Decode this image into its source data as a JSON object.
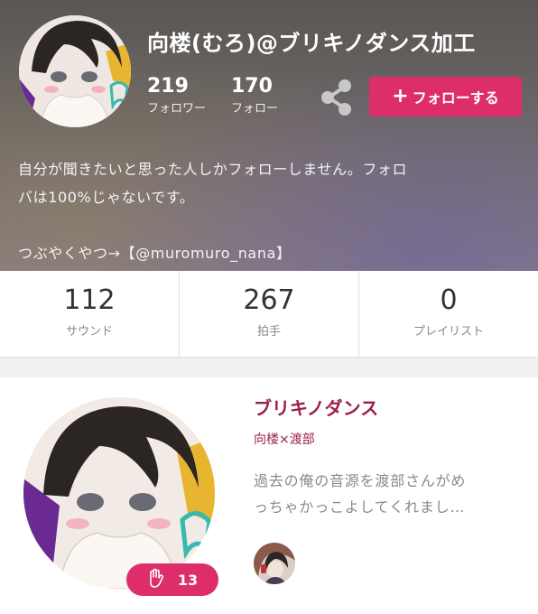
{
  "profile": {
    "username": "向楼(むろ)@ブリキノダンス加工",
    "followers_count": "219",
    "followers_label": "フォロワー",
    "following_count": "170",
    "following_label": "フォロー",
    "follow_button_label": "フォローする",
    "follow_plus": "+",
    "bio_lines": [
      "自分が聞きたいと思った人しかフォローしません。フォロ",
      "バは100%じゃないです。",
      "つぶやくやつ→【@muromuro_nana】"
    ],
    "share_icon": "share-icon"
  },
  "counts": [
    {
      "value": "112",
      "label": "サウンド"
    },
    {
      "value": "267",
      "label": "拍手"
    },
    {
      "value": "0",
      "label": "プレイリスト"
    }
  ],
  "track": {
    "title": "ブリキノダンス",
    "artist": "向楼×渡部",
    "description_lines": [
      "過去の俺の音源を渡部さんがめ",
      "っちゃかっこよしてくれまし…"
    ],
    "claps": "13",
    "clap_icon": "clap-hand-icon"
  },
  "colors": {
    "accent": "#dd2e6b",
    "track_title": "#9c1e4e",
    "header_bg": "#6c6764"
  }
}
